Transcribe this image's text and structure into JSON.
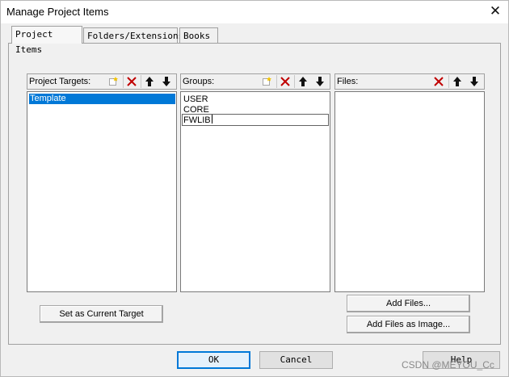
{
  "window": {
    "title": "Manage Project Items"
  },
  "tabs": [
    {
      "label": "Project Items",
      "active": true
    },
    {
      "label": "Folders/Extensions",
      "active": false
    },
    {
      "label": "Books",
      "active": false
    }
  ],
  "targets": {
    "label": "Project Targets:",
    "items": [
      "Template"
    ],
    "selected": "Template"
  },
  "groups": {
    "label": "Groups:",
    "items": [
      "USER",
      "CORE"
    ],
    "editing_value": "FWLIB"
  },
  "files": {
    "label": "Files:",
    "items": []
  },
  "buttons": {
    "set_current_target": "Set as Current Target",
    "add_files": "Add Files...",
    "add_files_image": "Add Files as Image...",
    "ok": "OK",
    "cancel": "Cancel",
    "help": "Help"
  },
  "watermark": "CSDN @MEYOU_Cc",
  "icons": {
    "new": "new-item-icon",
    "delete": "delete-icon",
    "up": "move-up-icon",
    "down": "move-down-icon",
    "close": "close-icon"
  },
  "colors": {
    "selection": "#0078d7",
    "delete_red": "#c00000"
  }
}
